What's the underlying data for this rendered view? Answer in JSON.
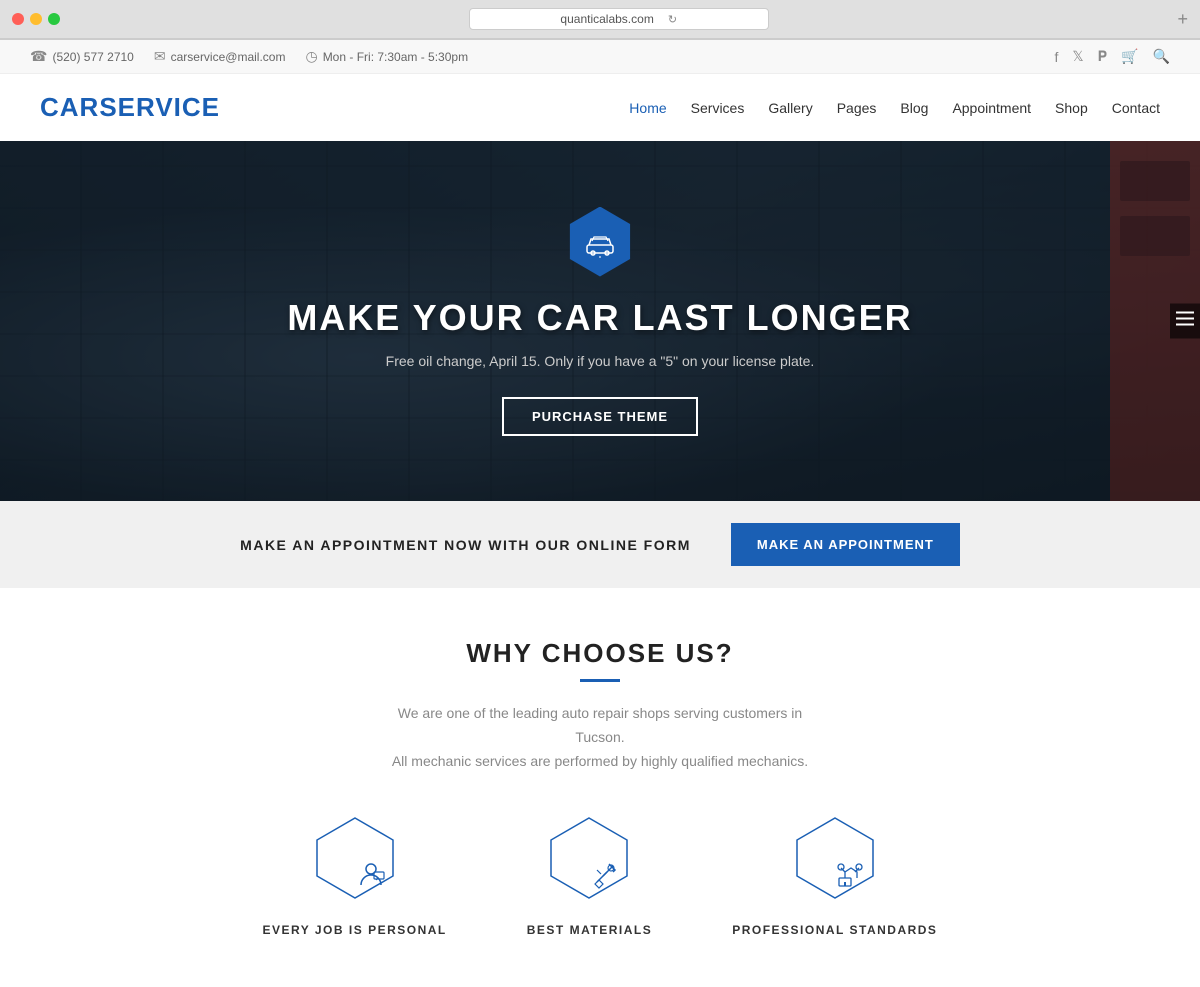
{
  "browser": {
    "url": "quanticalabs.com",
    "new_tab_label": "+"
  },
  "topbar": {
    "phone_icon": "☎",
    "phone": "(520) 577 2710",
    "email_icon": "✉",
    "email": "carservice@mail.com",
    "clock_icon": "◷",
    "hours": "Mon - Fri: 7:30am - 5:30pm",
    "facebook_icon": "f",
    "twitter_icon": "t",
    "pinterest_icon": "p",
    "cart_icon": "🛒",
    "search_icon": "🔍"
  },
  "nav": {
    "brand": "CARSERVICE",
    "links": [
      {
        "label": "Home",
        "active": true
      },
      {
        "label": "Services",
        "active": false
      },
      {
        "label": "Gallery",
        "active": false
      },
      {
        "label": "Pages",
        "active": false
      },
      {
        "label": "Blog",
        "active": false
      },
      {
        "label": "Appointment",
        "active": false
      },
      {
        "label": "Shop",
        "active": false
      },
      {
        "label": "Contact",
        "active": false
      }
    ]
  },
  "hero": {
    "hex_icon": "🚗",
    "title": "MAKE YOUR CAR LAST LONGER",
    "subtitle": "Free oil change, April 15. Only if you have a \"5\" on your license plate.",
    "button_label": "PURCHASE THEME",
    "sidebar_icon": "≡"
  },
  "appointment": {
    "text": "MAKE AN APPOINTMENT NOW WITH OUR ONLINE FORM",
    "button_label": "MAKE AN APPOINTMENT"
  },
  "why": {
    "title": "WHY CHOOSE US?",
    "subtitle": "We are one of the leading auto repair shops serving customers in Tucson.\nAll mechanic services are performed by highly qualified mechanics.",
    "cards": [
      {
        "label": "EVERY JOB IS PERSONAL",
        "icon": "👤"
      },
      {
        "label": "BEST MATERIALS",
        "icon": "🔧"
      },
      {
        "label": "PROFESSIONAL STANDARDS",
        "icon": "🏗"
      }
    ]
  }
}
